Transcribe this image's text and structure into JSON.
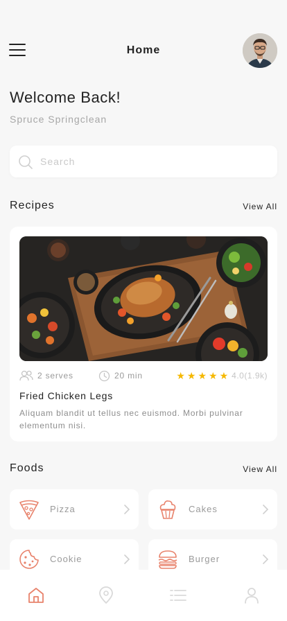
{
  "header": {
    "title": "Home"
  },
  "icons": {
    "menu": "hamburger-icon",
    "avatar": "user-avatar",
    "search": "search-icon",
    "serves": "users-icon",
    "time": "clock-icon",
    "rating": "star-icon",
    "chevron": "chevron-right-icon"
  },
  "greeting": {
    "title": "Welcome Back!",
    "name": "Spruce Springclean"
  },
  "search": {
    "placeholder": "Search",
    "value": ""
  },
  "recipes": {
    "title": "Recipes",
    "view_all": "View All",
    "featured": {
      "serves": "2 serves",
      "time": "20 min",
      "rating_value": 4.0,
      "rating_text": "4.0(1.9k)",
      "name": "Fried Chicken Legs",
      "description": "Aliquam blandit ut tellus nec euismod. Morbi pulvinar elementum nisi."
    }
  },
  "foods": {
    "title": "Foods",
    "view_all": "View All",
    "items": [
      {
        "label": "Pizza",
        "icon": "pizza-icon"
      },
      {
        "label": "Cakes",
        "icon": "cupcake-icon"
      },
      {
        "label": "Cookie",
        "icon": "cookie-icon"
      },
      {
        "label": "Burger",
        "icon": "burger-icon"
      }
    ]
  },
  "tabbar": {
    "items": [
      {
        "name": "home",
        "icon": "home-icon",
        "active": true
      },
      {
        "name": "location",
        "icon": "map-pin-icon",
        "active": false
      },
      {
        "name": "list",
        "icon": "list-icon",
        "active": false
      },
      {
        "name": "profile",
        "icon": "profile-icon",
        "active": false
      }
    ]
  },
  "colors": {
    "accent": "#e8826b",
    "star": "#f5b800",
    "background": "#f7f7f7",
    "muted_text": "#9a9a9a"
  }
}
